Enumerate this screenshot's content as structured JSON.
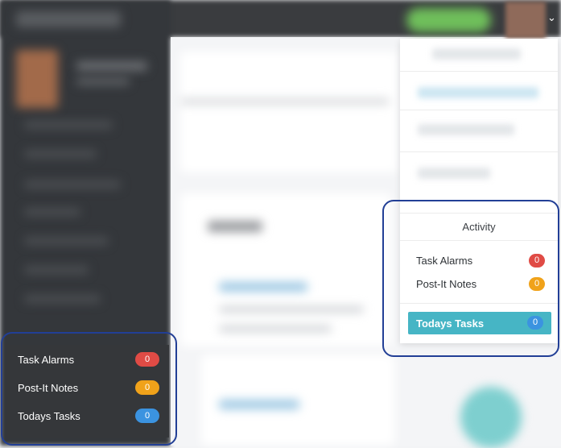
{
  "activity_dropdown": {
    "title": "Activity",
    "items": [
      {
        "label": "Task Alarms",
        "count": "0",
        "color": "#e04b45"
      },
      {
        "label": "Post-It Notes",
        "count": "0",
        "color": "#f0a21a"
      }
    ],
    "todays_tasks": {
      "label": "Todays Tasks",
      "count": "0",
      "color": "#3b93e0"
    }
  },
  "sidebar_panel": {
    "items": [
      {
        "label": "Task Alarms",
        "count": "0",
        "color": "#e04b45"
      },
      {
        "label": "Post-It Notes",
        "count": "0",
        "color": "#f0a21a"
      },
      {
        "label": "Todays Tasks",
        "count": "0",
        "color": "#3b93e0"
      }
    ]
  },
  "colors": {
    "highlight_outline": "#223f96",
    "todays_tasks_bg": "#46b5c5",
    "dark_panel_bg": "#35373a"
  }
}
